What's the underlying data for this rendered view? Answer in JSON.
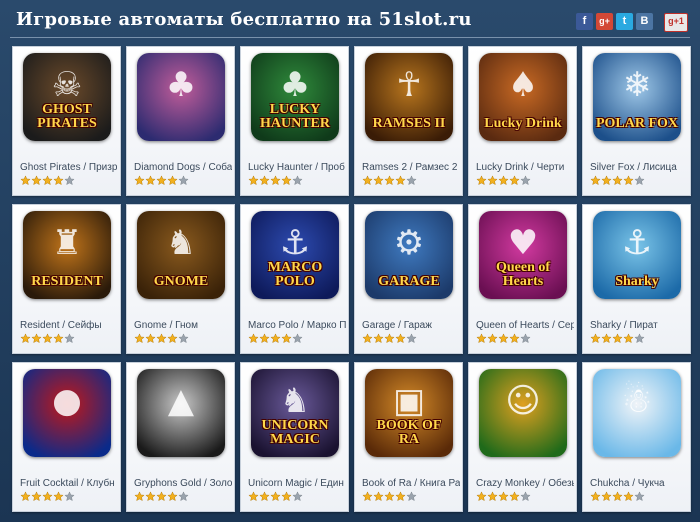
{
  "header": {
    "title": "Игровые автоматы бесплатно на 51slot.ru",
    "social": [
      {
        "name": "facebook",
        "label": "f"
      },
      {
        "name": "google-plus",
        "label": "g+"
      },
      {
        "name": "twitter",
        "label": "t"
      },
      {
        "name": "vkontakte",
        "label": "B"
      },
      {
        "name": "google-plus-one",
        "label": "g+1"
      }
    ]
  },
  "colors": {
    "background": "#1f3a57",
    "star_filled": "#f2b01e",
    "star_empty": "#9aa3ad"
  },
  "games": [
    {
      "name": "Ghost Pirates / Призр",
      "art_label": "GHOST PIRATES",
      "rating": 4,
      "colors": [
        "#1b1b1b",
        "#6b4a2a"
      ],
      "icon": "skull-icon"
    },
    {
      "name": "Diamond Dogs / Соба",
      "art_label": "",
      "rating": 4,
      "colors": [
        "#2c2b70",
        "#c25d9a"
      ],
      "icon": "dog-icon"
    },
    {
      "name": "Lucky Haunter / Проб",
      "art_label": "LUCKY HAUNTER",
      "rating": 4,
      "colors": [
        "#0f3a1a",
        "#2f8a3b"
      ],
      "icon": "leprechaun-icon"
    },
    {
      "name": "Ramses 2 / Рамзес 2",
      "art_label": "RAMSES II",
      "rating": 4,
      "colors": [
        "#3a1c06",
        "#b8761e"
      ],
      "icon": "pharaoh-icon"
    },
    {
      "name": "Lucky Drink / Черти",
      "art_label": "Lucky Drink",
      "rating": 4,
      "colors": [
        "#5a2a10",
        "#c96a24"
      ],
      "icon": "devil-icon"
    },
    {
      "name": "Silver Fox / Лисица",
      "art_label": "POLAR FOX",
      "rating": 4,
      "colors": [
        "#1c4f8a",
        "#9fc8e8"
      ],
      "icon": "fox-icon"
    },
    {
      "name": "Resident / Сейфы",
      "art_label": "RESIDENT",
      "rating": 4,
      "colors": [
        "#2a1a0a",
        "#c0741a"
      ],
      "icon": "agent-icon"
    },
    {
      "name": "Gnome / Гном",
      "art_label": "GNOME",
      "rating": 4,
      "colors": [
        "#3a2208",
        "#8a5a1e"
      ],
      "icon": "gnome-icon"
    },
    {
      "name": "Marco Polo / Марко П",
      "art_label": "MARCO POLO",
      "rating": 4,
      "colors": [
        "#0e1a5a",
        "#2d4bb0"
      ],
      "icon": "explorer-icon"
    },
    {
      "name": "Garage / Гараж",
      "art_label": "GARAGE",
      "rating": 4,
      "colors": [
        "#1c3a6a",
        "#3f7ac0"
      ],
      "icon": "mechanic-icon"
    },
    {
      "name": "Queen of Hearts / Сер",
      "art_label": "Queen of Hearts",
      "rating": 4,
      "colors": [
        "#6a0f52",
        "#d23aa0"
      ],
      "icon": "heart-icon"
    },
    {
      "name": "Sharky / Пират",
      "art_label": "Sharky",
      "rating": 4,
      "colors": [
        "#1c6aa8",
        "#7ac4e8"
      ],
      "icon": "pirate-icon"
    },
    {
      "name": "Fruit Cocktail / Клубн",
      "art_label": "",
      "rating": 4,
      "colors": [
        "#0a2a8a",
        "#c21818"
      ],
      "icon": "strawberry-icon"
    },
    {
      "name": "Gryphons Gold / Золо",
      "art_label": "",
      "rating": 4,
      "colors": [
        "#1a1a1a",
        "#c8c8c8"
      ],
      "icon": "eagle-icon"
    },
    {
      "name": "Unicorn Magic / Един",
      "art_label": "UNICORN MAGIC",
      "rating": 4,
      "colors": [
        "#1a1230",
        "#6a5a9a"
      ],
      "icon": "unicorn-icon"
    },
    {
      "name": "Book of Ra / Книга Ра",
      "art_label": "BOOK OF RA",
      "rating": 4,
      "colors": [
        "#5a2a08",
        "#d48a28"
      ],
      "icon": "book-icon"
    },
    {
      "name": "Crazy Monkey / Обезь",
      "art_label": "",
      "rating": 4,
      "colors": [
        "#1f6a1a",
        "#e0a020"
      ],
      "icon": "monkey-icon"
    },
    {
      "name": "Chukcha / Чукча",
      "art_label": "",
      "rating": 4,
      "colors": [
        "#6ab8e8",
        "#f0f4f8"
      ],
      "icon": "eskimo-icon"
    }
  ]
}
